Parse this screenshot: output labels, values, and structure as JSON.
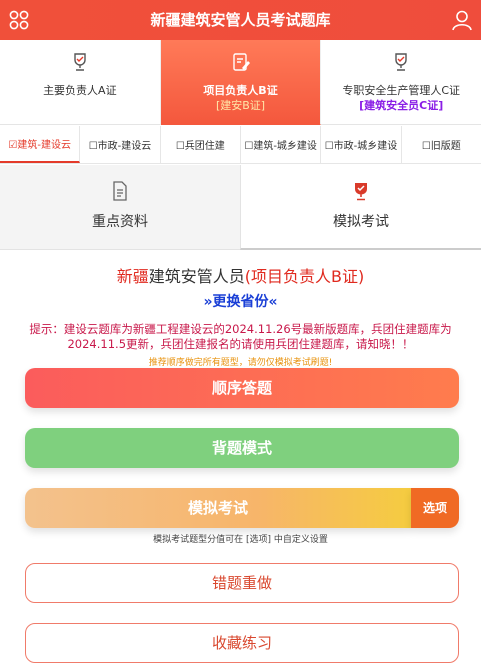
{
  "header": {
    "title": "新疆建筑安管人员考试题库",
    "menu_icon": "grid-menu-icon",
    "user_icon": "user-icon"
  },
  "cert_tabs": [
    {
      "label": "主要负责人A证",
      "sub": "",
      "icon": "trophy-icon",
      "active": false
    },
    {
      "label": "项目负责人B证",
      "sub": "[建安B证]",
      "icon": "edit-icon",
      "active": true
    },
    {
      "label": "专职安全生产管理人C证",
      "sub": "[建筑安全员C证]",
      "icon": "trophy-icon",
      "active": false
    }
  ],
  "region_tabs": [
    {
      "label": "☑建筑-建设云",
      "active": true
    },
    {
      "label": "☐市政-建设云",
      "active": false
    },
    {
      "label": "☐兵团住建",
      "active": false
    },
    {
      "label": "☐建筑-城乡建设",
      "active": false
    },
    {
      "label": "☐市政-城乡建设",
      "active": false
    },
    {
      "label": "☐旧版题",
      "active": false
    }
  ],
  "main_tabs": [
    {
      "label": "重点资料",
      "icon": "document-icon",
      "active": false
    },
    {
      "label": "模拟考试",
      "icon": "trophy-icon",
      "active": true
    }
  ],
  "info": {
    "headline_red1": "新疆",
    "headline_mid": "建筑安管人员",
    "headline_red2": "(项目负责人B证)",
    "change_province": "»更换省份«",
    "notice": "提示：建设云题库为新疆工程建设云的2024.11.26号最新版题库，兵团住建题库为2024.11.5更新，兵团住建报名的请使用兵团住建题库，请知晓！！"
  },
  "tip": "推荐顺序做完所有题型，请勿仅模拟考试刷题!",
  "buttons": {
    "order": "顺序答题",
    "recite": "背题模式",
    "mock": "模拟考试",
    "options": "选项",
    "mock_note": "模拟考试题型分值可在 [选项] 中自定义设置",
    "wrong": "错题重做",
    "favorite": "收藏练习"
  },
  "colors": {
    "header": "#ef4d3c",
    "accent_red": "#e02a1f",
    "link_blue": "#1a3fd6",
    "purple": "#8a1ee6",
    "notice": "#c8184a",
    "green": "#7fd07e",
    "orange": "#f06a24"
  }
}
